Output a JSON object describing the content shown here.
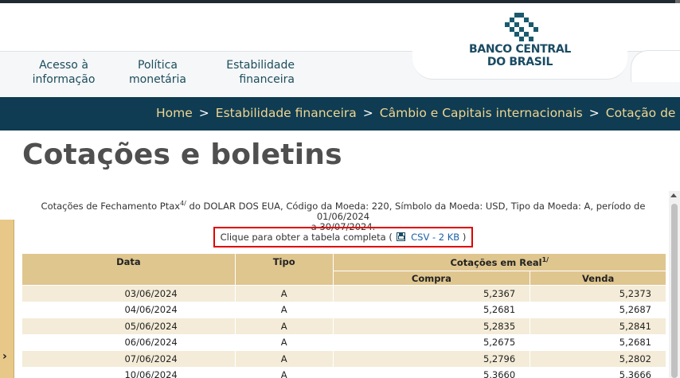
{
  "header": {
    "nav": [
      {
        "line1": "Acesso à",
        "line2": "informação"
      },
      {
        "line1": "Política",
        "line2": "monetária"
      },
      {
        "line1": "Estabilidade",
        "line2": "financeira"
      }
    ],
    "logo": {
      "line1": "BANCO CENTRAL",
      "line2": "DO BRASIL"
    }
  },
  "breadcrumb": [
    "Home",
    "Estabilidade financeira",
    "Câmbio e Capitais internacionais",
    "Cotação de moedas"
  ],
  "breadcrumb_separator": ">",
  "page_title": "Cotações e boletins",
  "description": {
    "part1": "Cotações de Fechamento Ptax",
    "sup": "4/",
    "part2": " do DOLAR DOS EUA, Código da Moeda: 220, Símbolo da Moeda: USD, Tipo da Moeda: A, período de 01/06/2024",
    "line2": "a 30/07/2024."
  },
  "csv": {
    "prefix": "Clique para obter a tabela completa (",
    "link": "CSV - 2 KB",
    "suffix": ")"
  },
  "table": {
    "headers": {
      "data": "Data",
      "tipo": "Tipo",
      "cotacoes": "Cotações em Real",
      "cotacoes_sup": "1/",
      "compra": "Compra",
      "venda": "Venda"
    },
    "rows": [
      {
        "data": "03/06/2024",
        "tipo": "A",
        "compra": "5,2367",
        "venda": "5,2373"
      },
      {
        "data": "04/06/2024",
        "tipo": "A",
        "compra": "5,2681",
        "venda": "5,2687"
      },
      {
        "data": "05/06/2024",
        "tipo": "A",
        "compra": "5,2835",
        "venda": "5,2841"
      },
      {
        "data": "06/06/2024",
        "tipo": "A",
        "compra": "5,2675",
        "venda": "5,2681"
      },
      {
        "data": "07/06/2024",
        "tipo": "A",
        "compra": "5,2796",
        "venda": "5,2802"
      },
      {
        "data": "10/06/2024",
        "tipo": "A",
        "compra": "5,3660",
        "venda": "5,3666"
      }
    ]
  },
  "side_panel": {
    "arrow": "›"
  },
  "colors": {
    "brand_dark": "#0f3c52",
    "crumb_text": "#f0d592",
    "table_header": "#dfc68f",
    "row_stripe": "#f4ecd8",
    "highlight_box": "#e00000"
  },
  "icons": [
    "logo-mark-icon",
    "floppy-disk-icon",
    "chevron-right-icon",
    "scroll-up-icon"
  ]
}
